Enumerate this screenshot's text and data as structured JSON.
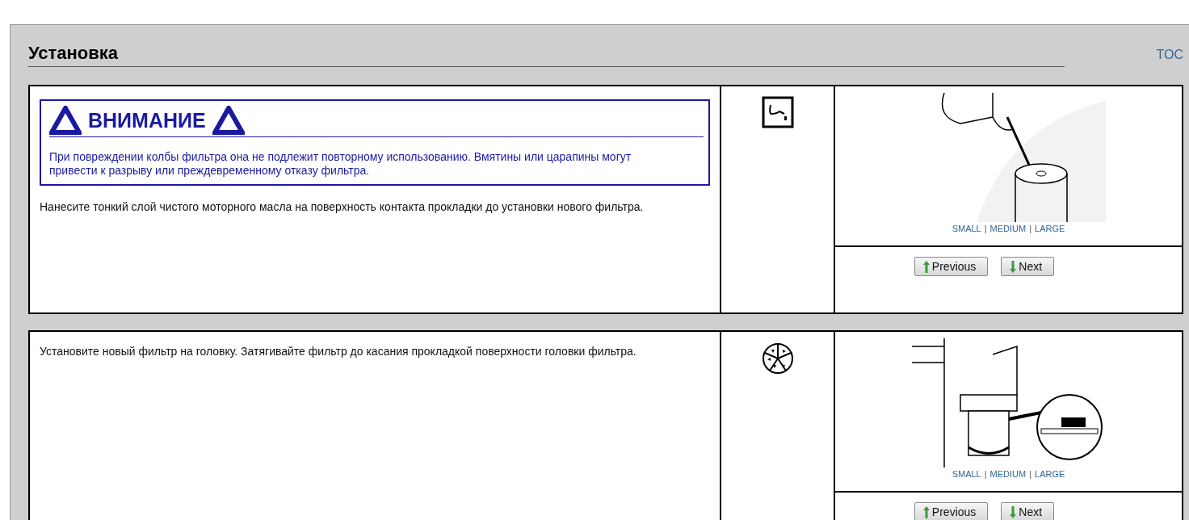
{
  "header": {
    "title": "Установка",
    "toc_link": "TOC"
  },
  "steps": [
    {
      "kind": "oil",
      "warning": {
        "heading": "ВНИМАНИЕ",
        "text": "При повреждении колбы фильтра она не подлежит повторному использованию. Вмятины или царапины могут привести к разрыву или преждевременному отказу фильтра."
      },
      "instruction": "Нанесите тонкий слой чистого моторного масла на поверхность контакта прокладки до установки нового фильтра.",
      "figure_links": [
        "SMALL",
        "MEDIUM",
        "LARGE"
      ],
      "link_separators": [
        "|",
        "|"
      ],
      "buttons": [
        "Previous",
        "Next"
      ]
    },
    {
      "kind": "tighten",
      "instruction": "Установите новый фильтр на головку. Затягивайте фильтр до касания прокладкой поверхности головки фильтра.",
      "figure_links": [
        "SMALL",
        "MEDIUM",
        "LARGE"
      ],
      "link_separators": [
        "|",
        "|"
      ],
      "buttons": [
        "Previous",
        "Next"
      ]
    }
  ]
}
